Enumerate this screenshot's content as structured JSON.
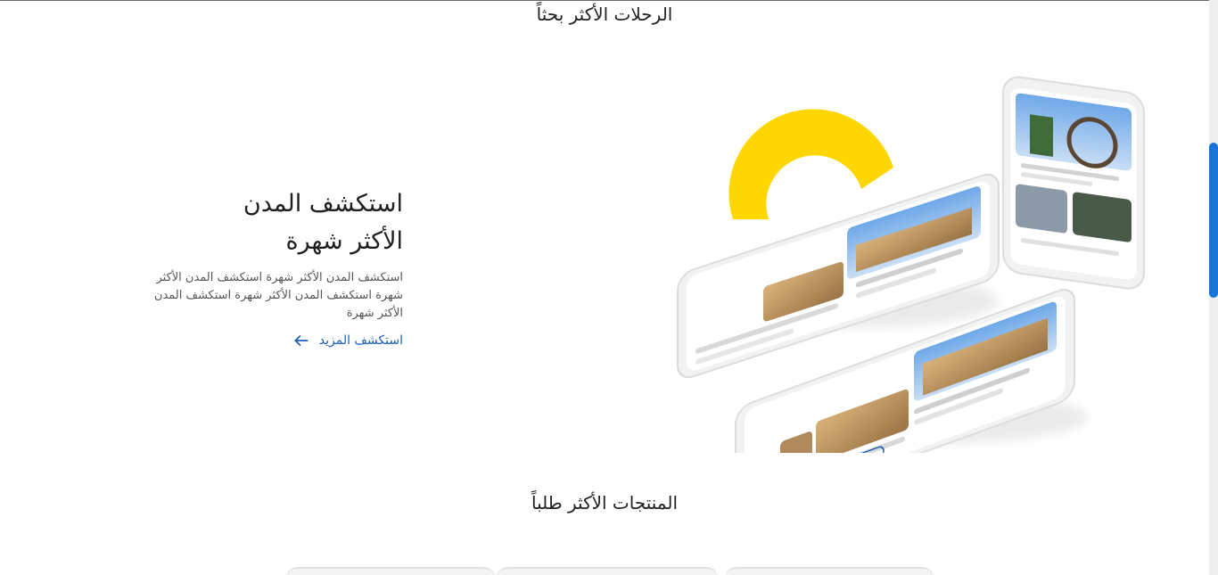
{
  "sections": {
    "trips_title": "الرحلات الأكثر بحثاً",
    "products_title": "المنتجات الأكثر طلباً"
  },
  "hero": {
    "heading_line1": "استكشف المدن",
    "heading_line2": "الأكثر شهرة",
    "description": "استكشف المدن الأكثر شهرة استكشف المدن الأكثر شهرة استكشف المدن الأكثر شهرة استكشف المدن الأكثر شهرة",
    "explore_link": "استكشف المزيد",
    "link_icon": "arrow-left-icon"
  },
  "colors": {
    "accent_yellow": "#FFD600",
    "link_blue": "#1A5FB4",
    "scroll_thumb": "#1A73D9"
  }
}
